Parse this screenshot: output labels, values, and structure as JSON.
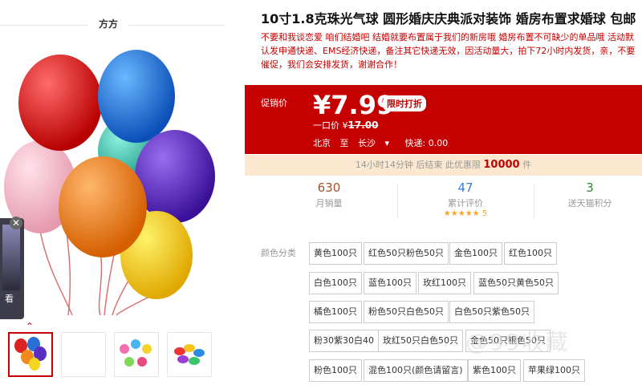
{
  "shop": {
    "name": "方方"
  },
  "left": {
    "mini_thumb_text": "看",
    "thumbs": [
      "balloons-main",
      "blank",
      "balloon-flowers",
      "balloon-pile"
    ]
  },
  "product": {
    "title": "10寸1.8克珠光气球 圆形婚庆庆典派对装饰 婚房布置求婚球 包邮",
    "description": "不要和我谈恋爱 咱们结婚吧 结婚就要布置属于我们的新房哦 婚房布置不可缺少的单品哦 活动默认发申通快递、EMS经济快递，备注其它快递无效，因活动量大，拍下72小时内发货，亲，不要催促，我们会安排发货，谢谢合作！"
  },
  "price": {
    "promo_label": "促销价",
    "symbol": "¥",
    "value": "7.99",
    "tag": "限时打折",
    "orig_label": "一口价 ¥",
    "orig_value": "17.00",
    "from": "北京",
    "to_label": "至",
    "to": "长沙",
    "arrow": "▾",
    "shipping": "快递: 0.00"
  },
  "timer": {
    "text_before": "14小时14分钟 后结束 此优惠限",
    "limit": "10000",
    "unit": "件"
  },
  "stats": [
    {
      "value": "630",
      "label": "月销量"
    },
    {
      "value": "47",
      "label": "累计评价",
      "stars": "★★★★★",
      "rating": "5"
    },
    {
      "value": "3",
      "label": "送天猫积分"
    }
  ],
  "options": {
    "label": "颜色分类",
    "items": [
      "黄色100只",
      "红色50只粉色50只",
      "金色100只",
      "红色100只",
      "白色100只",
      "蓝色100只",
      "玫红100只",
      "蓝色50只黄色50只",
      "橘色100只",
      "粉色50只白色50只",
      "白色50只紫色50只",
      "粉30紫30白40",
      "玫红50只白色50只",
      "金色50只银色50只",
      "粉色100只",
      "混色100只(颜色请留言)",
      "紫色100只",
      "苹果绿100只"
    ]
  },
  "watermark": "@99收藏"
}
